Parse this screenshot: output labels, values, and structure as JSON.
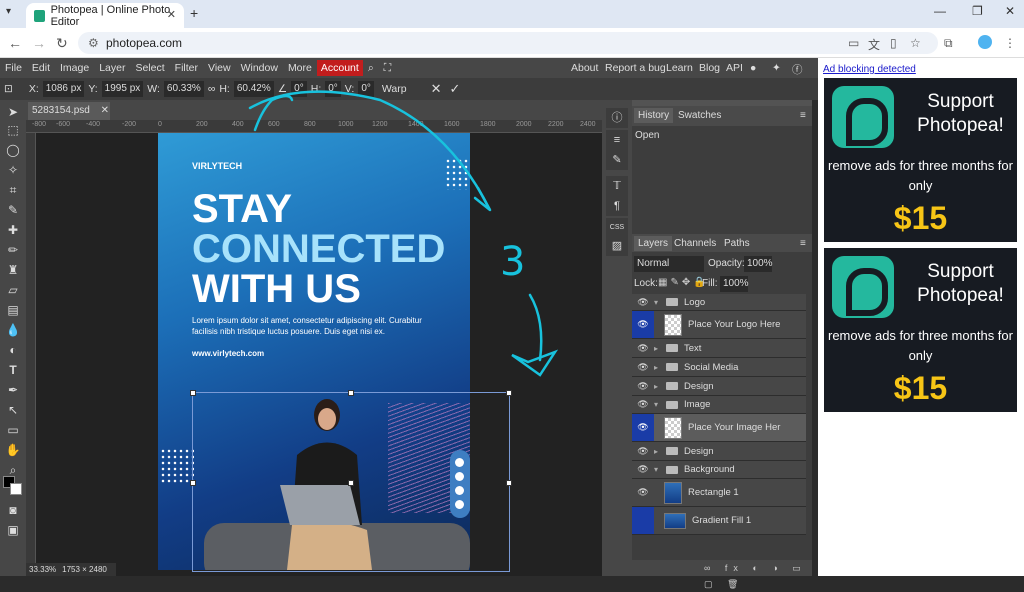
{
  "browser": {
    "tab_title": "Photopea | Online Photo Editor",
    "url": "photopea.com",
    "close_tab": "✕",
    "new_tab": "+",
    "window_min": "—",
    "window_max": "❐",
    "window_close": "✕"
  },
  "menubar": {
    "items": [
      "File",
      "Edit",
      "Image",
      "Layer",
      "Select",
      "Filter",
      "View",
      "Window",
      "More"
    ],
    "account": "Account",
    "right_items": [
      "About",
      "Report a bug",
      "Learn",
      "Blog",
      "API"
    ]
  },
  "options": {
    "x_label": "X:",
    "x_value": "1086 px",
    "y_label": "Y:",
    "y_value": "1995 px",
    "w_label": "W:",
    "w_value": "60.33%",
    "h_label": "H:",
    "h_value": "60.42%",
    "angle_value": "0°",
    "skew_h_label": "H:",
    "skew_h_value": "0°",
    "skew_v_label": "V:",
    "skew_v_value": "0°",
    "warp_label": "Warp"
  },
  "document": {
    "tab_name": "5283154.psd",
    "zoom": "33.33%",
    "dimensions": "1753 × 2480",
    "ruler_h": [
      "-800",
      "-600",
      "-400",
      "-200",
      "0",
      "200",
      "400",
      "600",
      "800",
      "1000",
      "1200",
      "1400",
      "1600",
      "1800",
      "2000",
      "2200",
      "2400"
    ]
  },
  "poster": {
    "logo": "VIRLYTECH",
    "line1": "STAY",
    "line2": "CONNECTED",
    "line3": "WITH US",
    "body": "Lorem ipsum dolor sit amet, consectetur adipiscing elit. Curabitur facilisis nibh tristique luctus posuere. Duis eget nisi ex.",
    "url": "www.virlytech.com"
  },
  "history": {
    "tabs": [
      "History",
      "Swatches"
    ],
    "items": [
      "Open"
    ]
  },
  "layers": {
    "tabs": [
      "Layers",
      "Channels",
      "Paths"
    ],
    "blend_mode": "Normal",
    "opacity_label": "Opacity:",
    "opacity": "100%",
    "lock_label": "Lock:",
    "fill_label": "Fill:",
    "fill": "100%",
    "rows": [
      {
        "name": "Logo",
        "type": "group",
        "open": true
      },
      {
        "name": "Place Your Logo Here",
        "type": "smart"
      },
      {
        "name": "Text",
        "type": "group",
        "open": false
      },
      {
        "name": "Social Media",
        "type": "group",
        "open": false
      },
      {
        "name": "Design",
        "type": "group",
        "open": false
      },
      {
        "name": "Image",
        "type": "group",
        "open": true
      },
      {
        "name": "Place Your Image Her",
        "type": "smart"
      },
      {
        "name": "Design",
        "type": "group",
        "open": false
      },
      {
        "name": "Background",
        "type": "group",
        "open": true
      },
      {
        "name": "Rectangle 1",
        "type": "shape"
      },
      {
        "name": "Gradient Fill 1",
        "type": "fill"
      }
    ]
  },
  "ads": {
    "label": "Ad blocking detected",
    "title": "Support Photopea!",
    "text": "remove ads for three months for only",
    "price": "$15"
  },
  "annotation": {
    "number": "3"
  },
  "colors": {
    "accent": "#c21d1d",
    "layer_selected": "#1a3ca7",
    "annotation": "#18c2dd",
    "ad_price": "#f7c516"
  }
}
